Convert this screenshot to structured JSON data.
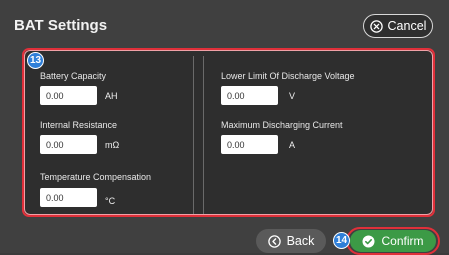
{
  "header": {
    "title": "BAT Settings",
    "cancel_label": "Cancel"
  },
  "badges": {
    "panel": "13",
    "confirm": "14"
  },
  "settings": {
    "battery_capacity": {
      "label": "Battery Capacity",
      "value": "0.00",
      "unit": "AH"
    },
    "internal_resistance": {
      "label": "Internal Resistance",
      "value": "0.00",
      "unit": "mΩ"
    },
    "temperature_compensation": {
      "label": "Temperature  Compensation",
      "value": "0.00",
      "unit": "°C"
    },
    "lower_limit_voltage": {
      "label": "Lower Limit Of Discharge Voltage",
      "value": "0.00",
      "unit": "V"
    },
    "max_discharging_current": {
      "label": "Maximum Discharging Current",
      "value": "0.00",
      "unit": "A"
    }
  },
  "footer": {
    "back_label": "Back",
    "confirm_label": "Confirm"
  },
  "colors": {
    "highlight": "#e0303a",
    "confirm": "#3c9a46",
    "badge": "#2f7fd8"
  },
  "icons": [
    "close-circle-icon",
    "back-circle-icon",
    "check-circle-icon"
  ]
}
